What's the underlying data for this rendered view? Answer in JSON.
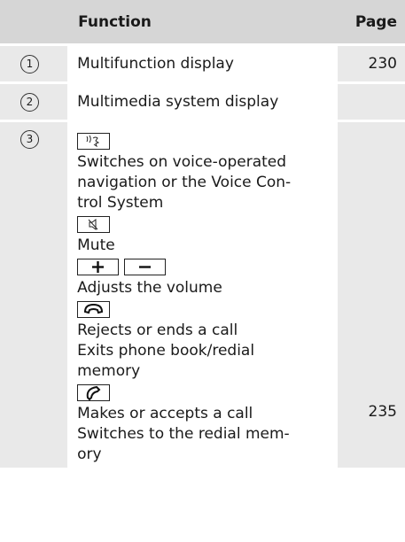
{
  "header": {
    "function": "Function",
    "page": "Page"
  },
  "rows": [
    {
      "num": "1",
      "text": "Multifunction display",
      "page": "230"
    },
    {
      "num": "2",
      "text": "Multimedia system display",
      "page": ""
    },
    {
      "num": "3",
      "page": "235",
      "items": [
        {
          "icon": "voice-control-icon",
          "lines": [
            "Switches on voice-operated",
            "navigation or the Voice Con-",
            "trol System"
          ]
        },
        {
          "icon": "mute-icon",
          "lines": [
            "Mute"
          ]
        },
        {
          "icon": "volume-icons",
          "lines": [
            "Adjusts the volume"
          ]
        },
        {
          "icon": "end-call-icon",
          "lines": [
            "Rejects or ends a call",
            "Exits phone book/redial",
            "memory"
          ]
        },
        {
          "icon": "accept-call-icon",
          "lines": [
            "Makes or accepts a call",
            "Switches to the redial mem-",
            "ory"
          ]
        }
      ]
    }
  ]
}
